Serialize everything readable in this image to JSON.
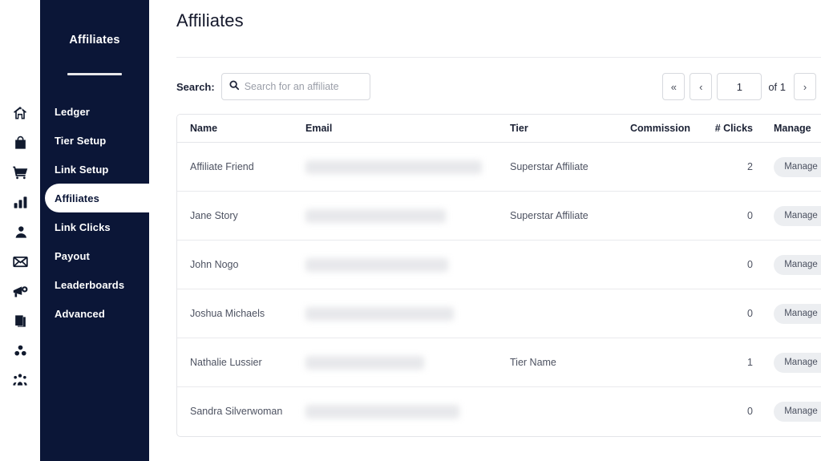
{
  "icon_rail": {
    "icons": [
      {
        "name": "home-icon"
      },
      {
        "name": "bag-icon"
      },
      {
        "name": "shopping-cart-icon"
      },
      {
        "name": "bar-chart-icon"
      },
      {
        "name": "user-icon"
      },
      {
        "name": "envelope-icon"
      },
      {
        "name": "megaphone-icon"
      },
      {
        "name": "book-icon"
      },
      {
        "name": "group-dots-icon"
      },
      {
        "name": "people-icon"
      }
    ]
  },
  "sidebar": {
    "title": "Affiliates",
    "items": [
      {
        "label": "Ledger",
        "active": false
      },
      {
        "label": "Tier Setup",
        "active": false
      },
      {
        "label": "Link Setup",
        "active": false
      },
      {
        "label": "Affiliates",
        "active": true
      },
      {
        "label": "Link Clicks",
        "active": false
      },
      {
        "label": "Payout",
        "active": false
      },
      {
        "label": "Leaderboards",
        "active": false
      },
      {
        "label": "Advanced",
        "active": false
      }
    ]
  },
  "header": {
    "title": "Affiliates",
    "help_label": "?"
  },
  "search": {
    "label": "Search:",
    "placeholder": "Search for an affiliate",
    "value": ""
  },
  "pagination": {
    "first_label": "«",
    "prev_label": "‹",
    "current_page": "1",
    "of_label": "of 1",
    "next_label": "›",
    "last_label": "»"
  },
  "table": {
    "columns": [
      "Name",
      "Email",
      "Tier",
      "Commission",
      "# Clicks",
      "Manage"
    ],
    "manage_label": "Manage",
    "rows": [
      {
        "name": "Affiliate Friend",
        "email": "",
        "email_redacted_width": 220,
        "tier": "Superstar Affiliate",
        "commission": "",
        "clicks": "2"
      },
      {
        "name": "Jane Story",
        "email": "",
        "email_redacted_width": 175,
        "tier": "Superstar Affiliate",
        "commission": "",
        "clicks": "0"
      },
      {
        "name": "John Nogo",
        "email": "",
        "email_redacted_width": 178,
        "tier": "",
        "commission": "",
        "clicks": "0"
      },
      {
        "name": "Joshua Michaels",
        "email": "",
        "email_redacted_width": 185,
        "tier": "",
        "commission": "",
        "clicks": "0"
      },
      {
        "name": "Nathalie Lussier",
        "email": "",
        "email_redacted_width": 148,
        "tier": "Tier Name",
        "commission": "",
        "clicks": "1"
      },
      {
        "name": "Sandra Silverwoman",
        "email": "",
        "email_redacted_width": 192,
        "tier": "",
        "commission": "",
        "clicks": "0"
      }
    ]
  },
  "colors": {
    "sidebar_navy": "#0b1637",
    "text_dark": "#14182b",
    "text_muted": "#4d5261",
    "border": "#e4e5e9",
    "button_gray": "#eceef1"
  }
}
